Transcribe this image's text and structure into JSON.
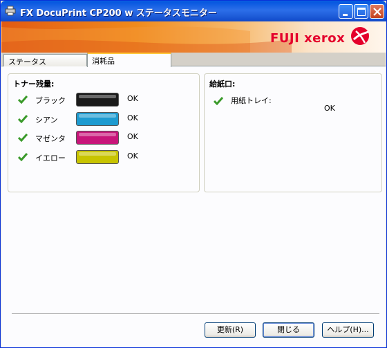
{
  "window": {
    "title": "FX DocuPrint CP200 w ステータスモニター"
  },
  "banner": {
    "logo_text": "FUJI xerox",
    "brand_color": "#E4002B"
  },
  "tabs": [
    {
      "label": "ステータス",
      "active": false
    },
    {
      "label": "消耗品",
      "active": true
    }
  ],
  "toner": {
    "title": "トナー残量:",
    "items": [
      {
        "label": "ブラック",
        "status": "OK",
        "color": "#1A1A1A"
      },
      {
        "label": "シアン",
        "status": "OK",
        "color": "#1E9BD0"
      },
      {
        "label": "マゼンタ",
        "status": "OK",
        "color": "#C8157A"
      },
      {
        "label": "イエロー",
        "status": "OK",
        "color": "#C8C400"
      }
    ]
  },
  "feed": {
    "title": "給紙口:",
    "tray_label": "用紙トレイ:",
    "tray_status": "OK"
  },
  "buttons": {
    "refresh": "更新(R)",
    "close": "閉じる",
    "help": "ヘルプ(H)..."
  },
  "icons": {
    "title": "printer-icon",
    "status_ok": "green-check-icon"
  }
}
